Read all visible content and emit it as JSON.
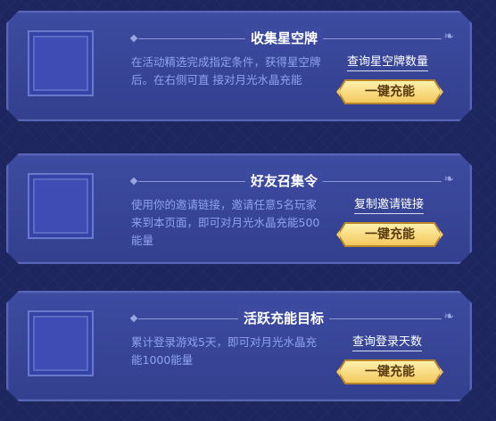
{
  "cards": [
    {
      "title": "收集星空牌",
      "description": "在活动精选完成指定条件，获得星空牌后。在右侧可直 接对月光水晶充能",
      "link": "查询星空牌数量",
      "button": "一键充能"
    },
    {
      "title": "好友召集令",
      "description": "使用你的邀请链接，邀请任意5名玩家来到本页面，即可对月光水晶充能500能量",
      "link": "复制邀请链接",
      "button": "一键充能"
    },
    {
      "title": "活跃充能目标",
      "description": "累计登录游戏5天，即可对月光水晶充能1000能量",
      "link": "查询登录天数",
      "button": "一键充能"
    }
  ]
}
